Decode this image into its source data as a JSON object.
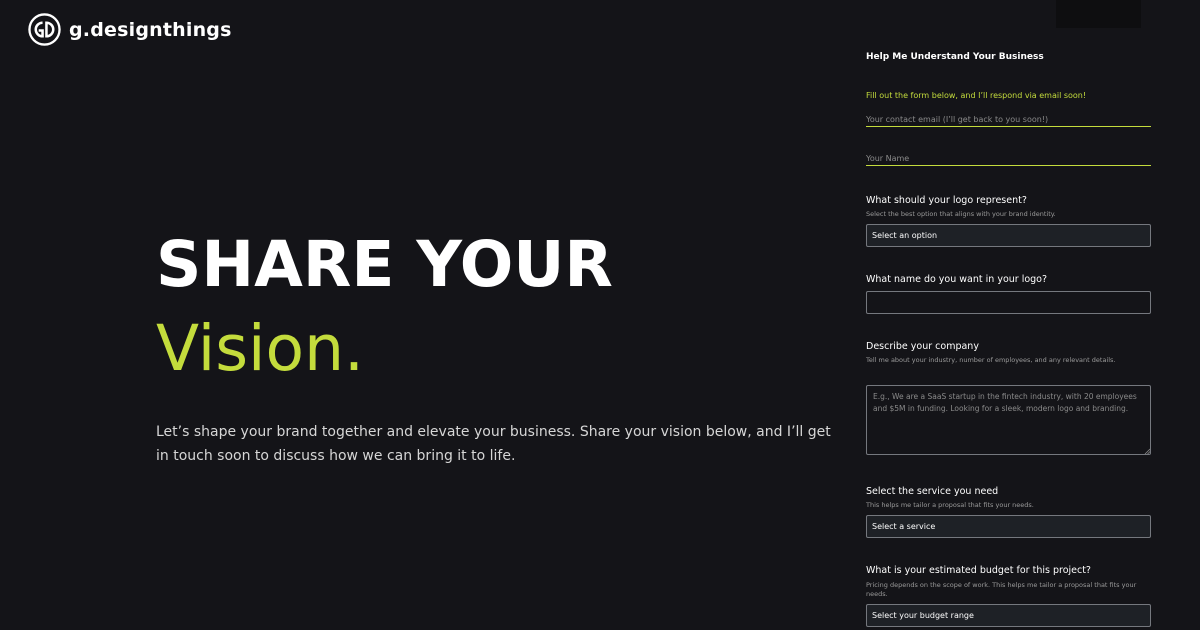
{
  "brand": {
    "name": "g.designthings",
    "icon": "gd-logo-icon"
  },
  "hero": {
    "title": "SHARE YOUR",
    "accent": "Vision.",
    "description": "Let’s shape your brand together and elevate your business. Share your vision below, and I’ll get in touch soon to discuss how we can bring it to life."
  },
  "form": {
    "title": "Help Me Understand Your Business",
    "subtitle": "Fill out the form below, and I’ll respond via email soon!",
    "email_placeholder": "Your contact email (I’ll get back to you soon!)",
    "name_placeholder": "Your Name",
    "logo_represent": {
      "label": "What should your logo represent?",
      "help": "Select the best option that aligns with your brand identity.",
      "value": "Select an option"
    },
    "logo_name": {
      "label": "What name do you want in your logo?"
    },
    "company": {
      "label": "Describe your company",
      "help": "Tell me about your industry, number of employees, and any relevant details.",
      "placeholder": "E.g., We are a SaaS startup in the fintech industry, with 20 employees and $5M in funding. Looking for a sleek, modern logo and branding."
    },
    "service": {
      "label": "Select the service you need",
      "help": "This helps me tailor a proposal that fits your needs.",
      "value": "Select a service"
    },
    "budget": {
      "label": "What is your estimated budget for this project?",
      "help": "Pricing depends on the scope of work. This helps me tailor a proposal that fits your needs.",
      "value": "Select your budget range"
    }
  },
  "colors": {
    "background": "#141418",
    "accent": "#c4dc3c",
    "field_bg": "#1e2126"
  }
}
